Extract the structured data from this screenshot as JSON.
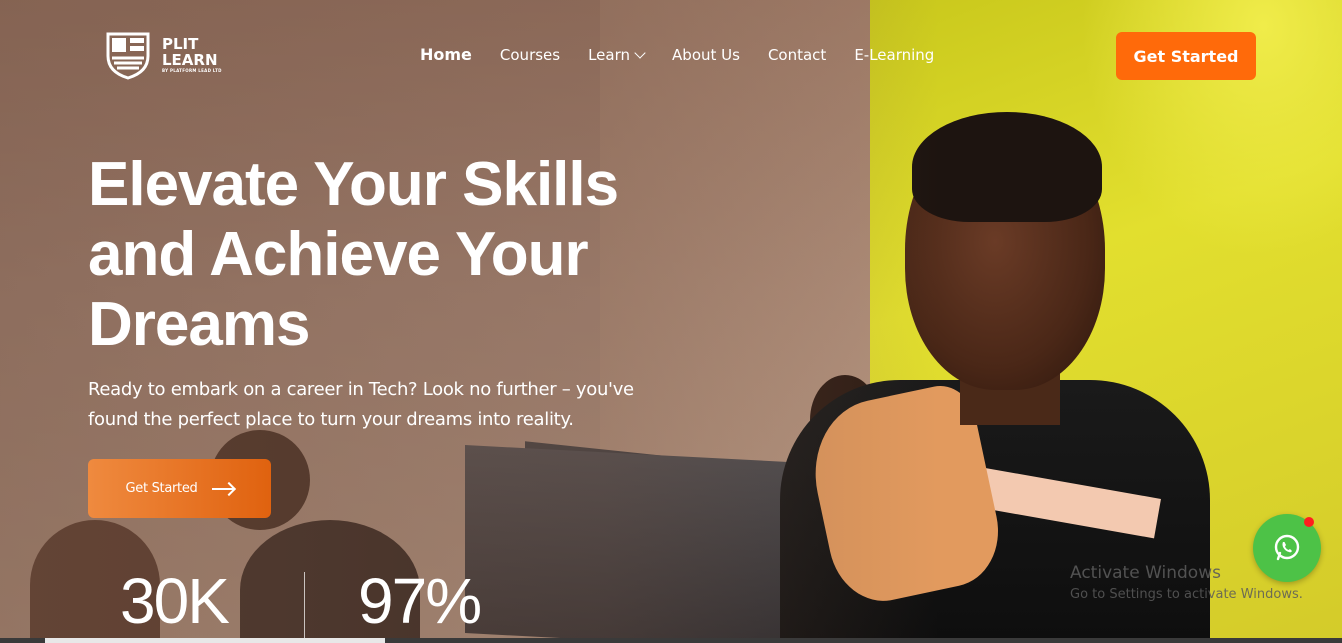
{
  "header": {
    "logo": {
      "line1": "PLIT",
      "line2": "LEARN",
      "line3": "BY PLATFORM LEAD LTD"
    },
    "nav": [
      {
        "label": "Home",
        "active": true
      },
      {
        "label": "Courses"
      },
      {
        "label": "Learn",
        "dropdown": true
      },
      {
        "label": "About Us"
      },
      {
        "label": "Contact"
      },
      {
        "label": "E-Learning"
      }
    ],
    "cta_label": "Get Started"
  },
  "hero": {
    "title": "Elevate Your Skills and Achieve Your Dreams",
    "subtitle": "Ready to embark on a career in Tech? Look no further – you've found the perfect place to turn your dreams into reality.",
    "cta_label": "Get Started"
  },
  "stats": [
    {
      "value": "30K"
    },
    {
      "value": "97%"
    }
  ],
  "windows_watermark": {
    "title": "Activate Windows",
    "subtitle": "Go to Settings to activate Windows."
  },
  "colors": {
    "accent": "#ff6a0a",
    "whatsapp": "#4dc247",
    "notification": "#ff1e1e"
  },
  "icons": {
    "whatsapp": "whatsapp-icon",
    "arrow": "arrow-right-icon",
    "chevron": "chevron-down-icon"
  }
}
